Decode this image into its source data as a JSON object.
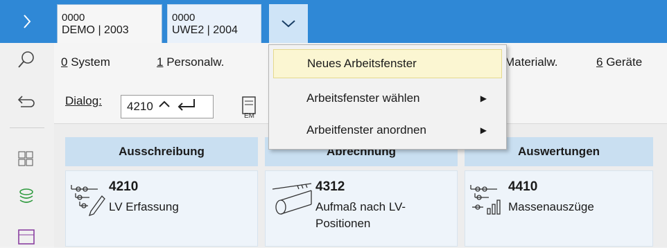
{
  "colors": {
    "topbar": "#2f88d6",
    "column_header": "#c9dff1",
    "highlight": "#fbf6d2"
  },
  "window_tabs": [
    {
      "line1": "0000",
      "line2": "DEMO | 2003"
    },
    {
      "line1": "0000",
      "line2": "UWE2 | 2004"
    }
  ],
  "left_rail": {
    "icons": [
      "search-icon",
      "back-icon",
      "modules-icon",
      "stack-icon",
      "layout-icon"
    ]
  },
  "menubar": [
    {
      "key": "0",
      "label": " System"
    },
    {
      "key": "1",
      "label": " Personalw."
    },
    {
      "key": "",
      "label": "Materialw."
    },
    {
      "key": "6",
      "label": " Geräte"
    }
  ],
  "dialog": {
    "label": "Dialog:",
    "value": "4210"
  },
  "columns": [
    {
      "title": "Ausschreibung",
      "code": "4210",
      "text": "LV Erfassung"
    },
    {
      "title": "Abrechnung",
      "code": "4312",
      "text": "Aufmaß nach LV-Positionen"
    },
    {
      "title": "Auswertungen",
      "code": "4410",
      "text": "Massenauszüge"
    }
  ],
  "dropdown": {
    "items": [
      {
        "label": "Neues Arbeitsfenster",
        "submenu": false
      },
      {
        "label": "Arbeitsfenster wählen",
        "submenu": true
      },
      {
        "label": "Arbeitfenster anordnen",
        "submenu": true
      }
    ]
  }
}
